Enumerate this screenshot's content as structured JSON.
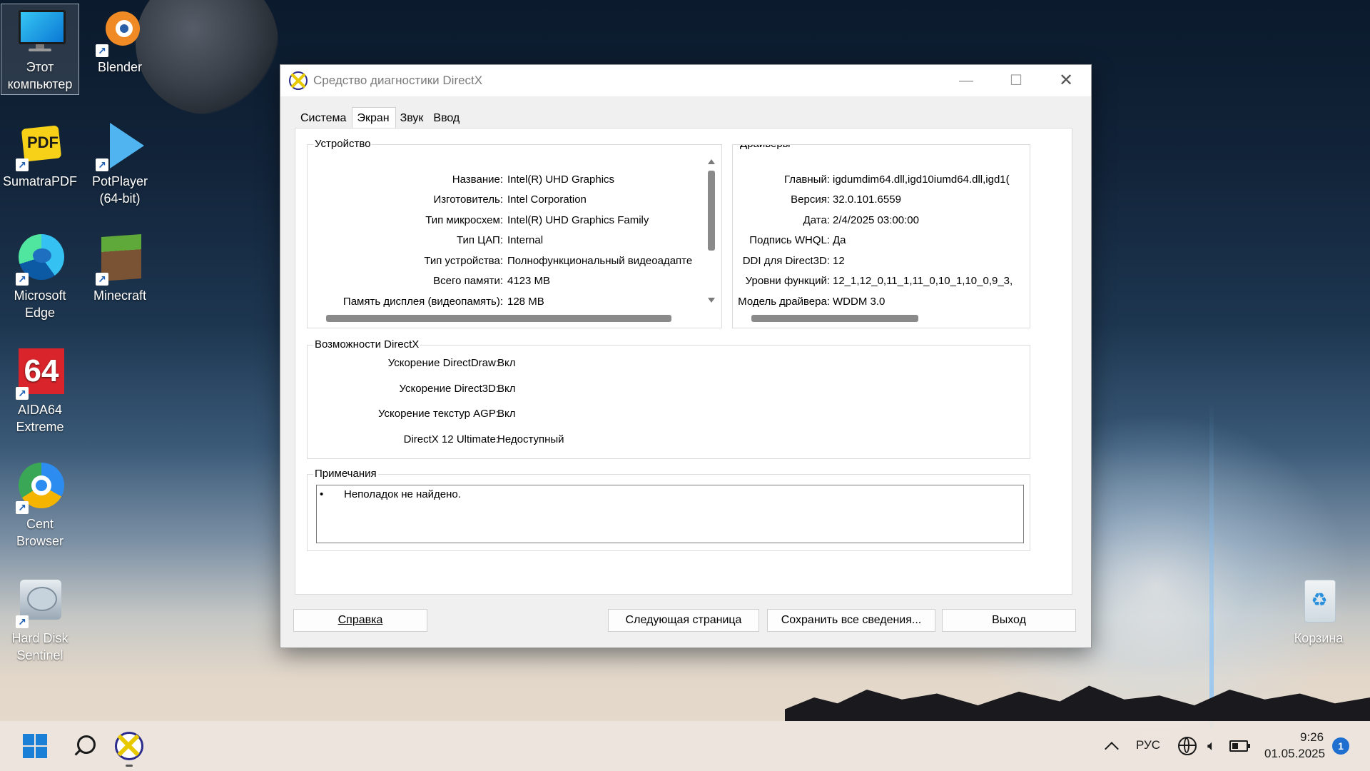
{
  "desktop": {
    "icons": [
      {
        "label": "Этот компьютер"
      },
      {
        "label": "Blender"
      },
      {
        "label": "SumatraPDF"
      },
      {
        "label": "PotPlayer (64-bit)"
      },
      {
        "label": "Microsoft Edge"
      },
      {
        "label": "Minecraft"
      },
      {
        "label": "AIDA64 Extreme"
      },
      {
        "label": "Cent Browser"
      },
      {
        "label": "Hard Disk Sentinel"
      },
      {
        "label": "Корзина"
      }
    ],
    "sumatra_badge": "PDF",
    "aida_badge": "64"
  },
  "window": {
    "title": "Средство диагностики DirectX",
    "controls": {
      "minimize": "—",
      "maximize": "☐",
      "close": "✕"
    },
    "tabs": [
      "Система",
      "Экран",
      "Звук",
      "Ввод"
    ],
    "active_tab": "Экран",
    "device": {
      "title": "Устройство",
      "rows": [
        {
          "k": "Название:",
          "v": "Intel(R) UHD Graphics"
        },
        {
          "k": "Изготовитель:",
          "v": "Intel Corporation"
        },
        {
          "k": "Тип микросхем:",
          "v": "Intel(R) UHD Graphics Family"
        },
        {
          "k": "Тип ЦАП:",
          "v": "Internal"
        },
        {
          "k": "Тип устройства:",
          "v": "Полнофункциональный видеоадапте"
        },
        {
          "k": "Всего памяти:",
          "v": "4123 MB"
        },
        {
          "k": "Память дисплея (видеопамять):",
          "v": "128 MB"
        }
      ]
    },
    "drivers": {
      "title": "Драйверы",
      "rows": [
        {
          "k": "Главный:",
          "v": "igdumdim64.dll,igd10iumd64.dll,igd1("
        },
        {
          "k": "Версия:",
          "v": "32.0.101.6559"
        },
        {
          "k": "Дата:",
          "v": "2/4/2025 03:00:00"
        },
        {
          "k": "Подпись WHQL:",
          "v": "Да"
        },
        {
          "k": "DDI для Direct3D:",
          "v": "12"
        },
        {
          "k": "Уровни функций:",
          "v": "12_1,12_0,11_1,11_0,10_1,10_0,9_3,"
        },
        {
          "k": "Модель драйвера:",
          "v": "WDDM 3.0"
        }
      ]
    },
    "features": {
      "title": "Возможности DirectX",
      "rows": [
        {
          "k": "Ускорение DirectDraw:",
          "v": "Вкл"
        },
        {
          "k": "Ускорение Direct3D:",
          "v": "Вкл"
        },
        {
          "k": "Ускорение текстур AGP:",
          "v": "Вкл"
        },
        {
          "k": "DirectX 12 Ultimate:",
          "v": "Недоступный"
        }
      ]
    },
    "notes": {
      "title": "Примечания",
      "bullet": "•",
      "text": "Неполадок не найдено."
    },
    "buttons": {
      "help": "Справка",
      "next": "Следующая страница",
      "save": "Сохранить все сведения...",
      "exit": "Выход"
    }
  },
  "taskbar": {
    "language": "РУС",
    "time": "9:26",
    "date": "01.05.2025",
    "notification_count": "1"
  }
}
